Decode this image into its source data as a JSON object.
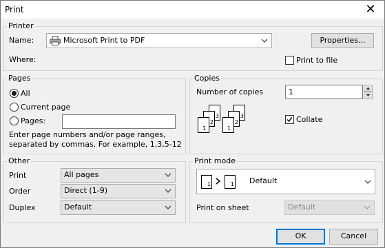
{
  "window": {
    "title": "Print",
    "close_glyph": "✕"
  },
  "printer": {
    "group_label": "Printer",
    "name_label": "Name:",
    "name_value": "Microsoft Print to PDF",
    "properties_label": "Properties...",
    "where_label": "Where:",
    "print_to_file_label": "Print to file",
    "print_to_file_checked": false
  },
  "pages": {
    "group_label": "Pages",
    "all_label": "All",
    "current_label": "Current page",
    "pages_label": "Pages:",
    "pages_value": "",
    "selected": "All",
    "hint_line1": "Enter page numbers and/or page ranges,",
    "hint_line2": "separated by commas. For example, 1,3,5-12"
  },
  "copies": {
    "group_label": "Copies",
    "number_label": "Number of copies",
    "number_value": "1",
    "collate_label": "Collate",
    "collate_checked": true,
    "collate_icon_pages": [
      "1",
      "2",
      "3"
    ]
  },
  "other": {
    "group_label": "Other",
    "print_label": "Print",
    "print_value": "All pages",
    "order_label": "Order",
    "order_value": "Direct (1-9)",
    "duplex_label": "Duplex",
    "duplex_value": "Default"
  },
  "print_mode": {
    "group_label": "Print mode",
    "mode_value": "Default",
    "mode_icon_pages": [
      "1",
      "1"
    ],
    "on_sheet_label": "Print on sheet",
    "on_sheet_value": "Default"
  },
  "buttons": {
    "ok": "OK",
    "cancel": "Cancel"
  },
  "colors": {
    "accent": "#0078d7",
    "background": "#f0f0f0"
  }
}
